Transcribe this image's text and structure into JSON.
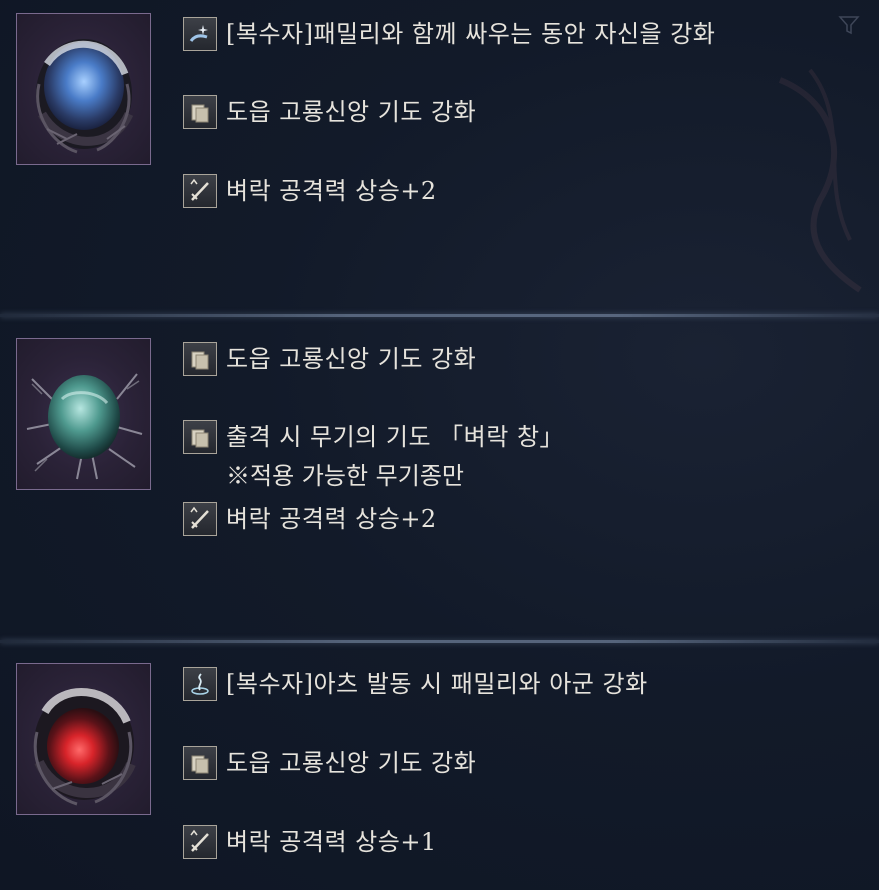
{
  "relics": [
    {
      "gem_color": "blue",
      "effects": [
        {
          "icon": "avenger-sparkle-hand-icon",
          "text": "[복수자]패밀리와 함께 싸우는 동안 자신을 강화"
        },
        {
          "icon": "tome-icon",
          "text": "도읍 고룡신앙 기도 강화"
        },
        {
          "icon": "sword-up-icon",
          "text": "벼락 공격력 상승+2"
        }
      ]
    },
    {
      "gem_color": "teal",
      "effects": [
        {
          "icon": "tome-icon",
          "text": "도읍 고룡신앙 기도 강화"
        },
        {
          "icon": "tome-icon",
          "text": "출격 시 무기의 기도 「벼락 창」",
          "note": "※적용 가능한 무기종만"
        },
        {
          "icon": "sword-up-icon",
          "text": "벼락 공격력 상승+2"
        }
      ]
    },
    {
      "gem_color": "red",
      "effects": [
        {
          "icon": "avenger-spiral-icon",
          "text": "[복수자]아츠 발동 시 패밀리와 아군 강화"
        },
        {
          "icon": "tome-icon",
          "text": "도읍 고룡신앙 기도 강화"
        },
        {
          "icon": "sword-up-icon",
          "text": "벼락 공격력 상승+1"
        }
      ]
    }
  ],
  "colors": {
    "background": "#121a29",
    "frame_border": "#7a6a8e",
    "text": "#e6e3dc",
    "gem_blue": "#5a8fd8",
    "gem_teal": "#4f9a8f",
    "gem_red": "#d8242a"
  }
}
